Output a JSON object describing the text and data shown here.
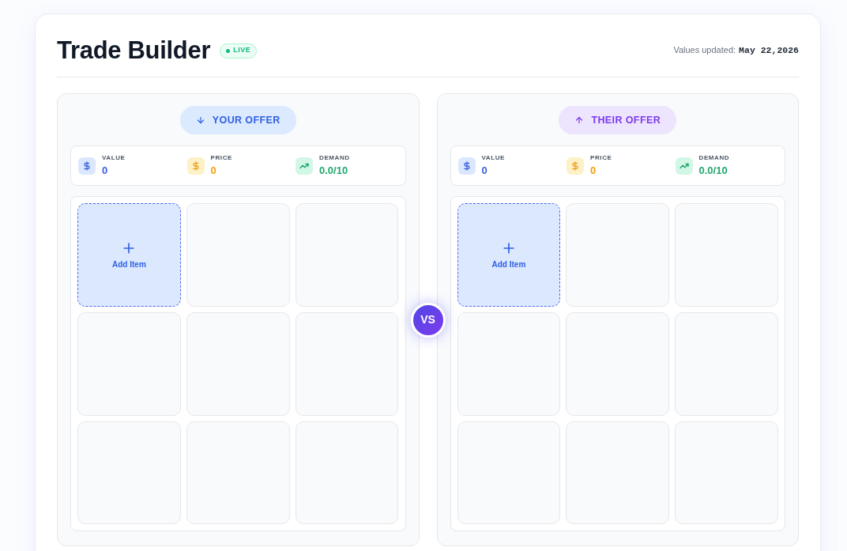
{
  "header": {
    "title": "Trade Builder",
    "badge": "LIVE",
    "updated_label": "Values updated:",
    "updated_date": "May 22,2026"
  },
  "panels": [
    {
      "kind": "yours",
      "label": "YOUR OFFER",
      "stats": [
        {
          "kind": "value",
          "label": "VALUE",
          "value": "0"
        },
        {
          "kind": "price",
          "label": "PRICE",
          "value": "0"
        },
        {
          "kind": "demand",
          "label": "DEMAND",
          "value": "0.0/10"
        }
      ],
      "slots": [
        {
          "kind": "add",
          "label": "Add Item"
        },
        {
          "kind": "empty"
        },
        {
          "kind": "empty"
        },
        {
          "kind": "empty"
        },
        {
          "kind": "empty"
        },
        {
          "kind": "empty"
        },
        {
          "kind": "empty"
        },
        {
          "kind": "empty"
        },
        {
          "kind": "empty"
        }
      ]
    },
    {
      "kind": "theirs",
      "label": "THEIR OFFER",
      "stats": [
        {
          "kind": "value",
          "label": "VALUE",
          "value": "0"
        },
        {
          "kind": "price",
          "label": "PRICE",
          "value": "0"
        },
        {
          "kind": "demand",
          "label": "DEMAND",
          "value": "0.0/10"
        }
      ],
      "slots": [
        {
          "kind": "add",
          "label": "Add Item"
        },
        {
          "kind": "empty"
        },
        {
          "kind": "empty"
        },
        {
          "kind": "empty"
        },
        {
          "kind": "empty"
        },
        {
          "kind": "empty"
        },
        {
          "kind": "empty"
        },
        {
          "kind": "empty"
        },
        {
          "kind": "empty"
        }
      ]
    }
  ],
  "divider_badge": "VS"
}
